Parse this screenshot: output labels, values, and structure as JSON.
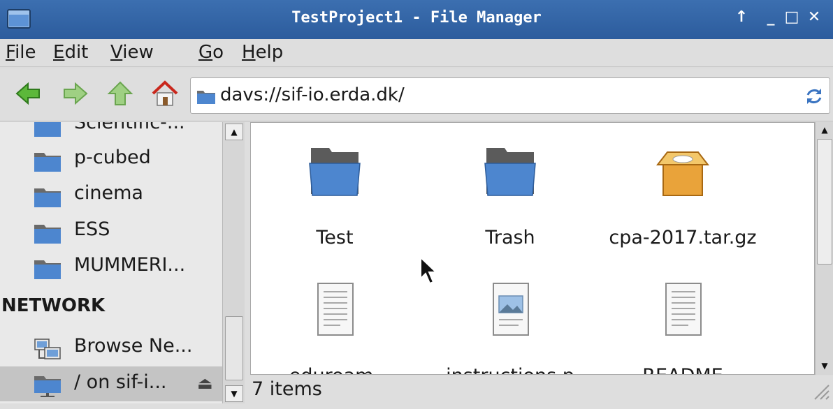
{
  "window": {
    "title": "TestProject1 - File Manager",
    "controls": {
      "keep_above": "↑",
      "minimize": "_",
      "maximize": "□",
      "close": "✕"
    }
  },
  "menubar": {
    "items": [
      {
        "mnemonic": "F",
        "rest": "ile"
      },
      {
        "mnemonic": "E",
        "rest": "dit"
      },
      {
        "mnemonic": "V",
        "rest": "iew"
      },
      {
        "mnemonic": "G",
        "rest": "o"
      },
      {
        "mnemonic": "H",
        "rest": "elp"
      }
    ]
  },
  "toolbar": {
    "buttons": [
      "back-arrow-icon",
      "forward-arrow-icon",
      "up-arrow-icon",
      "home-icon"
    ],
    "location": "davs://sif-io.erda.dk/"
  },
  "sidebar": {
    "items_top": [
      {
        "label": "Scientific-...",
        "icon": "folder-icon"
      },
      {
        "label": "p-cubed",
        "icon": "folder-icon"
      },
      {
        "label": "cinema",
        "icon": "folder-icon"
      },
      {
        "label": "ESS",
        "icon": "folder-icon"
      },
      {
        "label": "MUMMERI...",
        "icon": "folder-icon"
      }
    ],
    "network_heading": "NETWORK",
    "network_items": [
      {
        "label": "Browse Ne...",
        "icon": "network-icon"
      },
      {
        "label": "/ on sif-i...",
        "icon": "remote-folder-icon",
        "selected": true,
        "eject": "⏏"
      }
    ]
  },
  "files": [
    {
      "name": "Test",
      "icon": "folder-icon"
    },
    {
      "name": "Trash",
      "icon": "folder-icon"
    },
    {
      "name": "cpa-2017.tar.gz",
      "icon": "archive-icon"
    },
    {
      "name": "eduroam-",
      "icon": "text-document-icon"
    },
    {
      "name": "instructions.p",
      "icon": "image-document-icon"
    },
    {
      "name": "README",
      "icon": "text-document-icon"
    }
  ],
  "status": {
    "text": "7 items"
  },
  "colors": {
    "titlebar": "#2c5c9d",
    "folder_blue": "#4d86cf",
    "archive_orange": "#e9a33a"
  }
}
